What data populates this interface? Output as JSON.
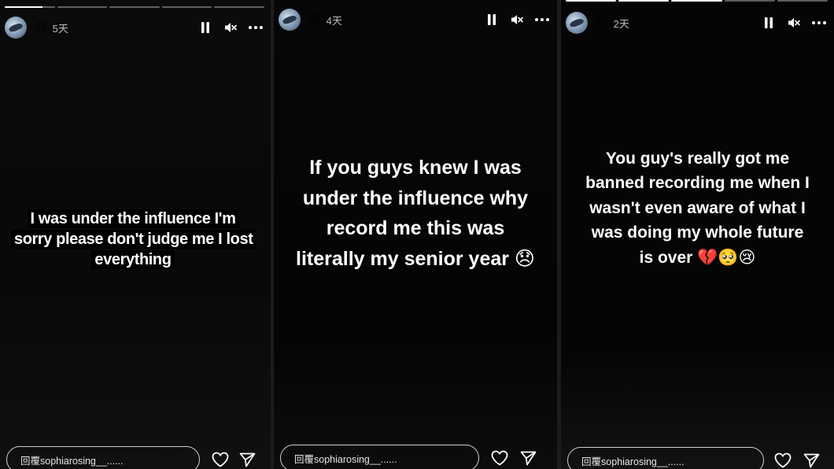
{
  "panels": [
    {
      "mood_emoji": "😞",
      "time": "5天",
      "story_text": "I was under the influence I'm sorry please don't judge me I lost everything",
      "reply_placeholder": "回覆sophiarosing__......",
      "progress_filled": [
        1,
        0,
        0,
        0,
        0
      ]
    },
    {
      "mood_emoji": "😞",
      "time": "4天",
      "story_text": "If you guys knew I was under the influence why record me this was literally my senior year 😞",
      "reply_placeholder": "回覆sophiarosing__......",
      "progress_filled": []
    },
    {
      "mood_emoji": "😞",
      "time": "2天",
      "story_text": "You guy's really got me banned recording me when I wasn't even aware of what I was doing my whole future is over 💔🥺😢",
      "reply_placeholder": "回覆sophiarosing__......",
      "progress_filled": [
        1,
        1,
        1,
        0,
        0
      ]
    }
  ],
  "icons": {
    "pause": "pause-icon",
    "mute": "speaker-muted-icon",
    "more": "more-icon",
    "like": "heart-icon",
    "share": "send-icon"
  },
  "colors": {
    "text": "#ffffff",
    "background": "#050505",
    "muted_text": "#bdbdbd"
  }
}
